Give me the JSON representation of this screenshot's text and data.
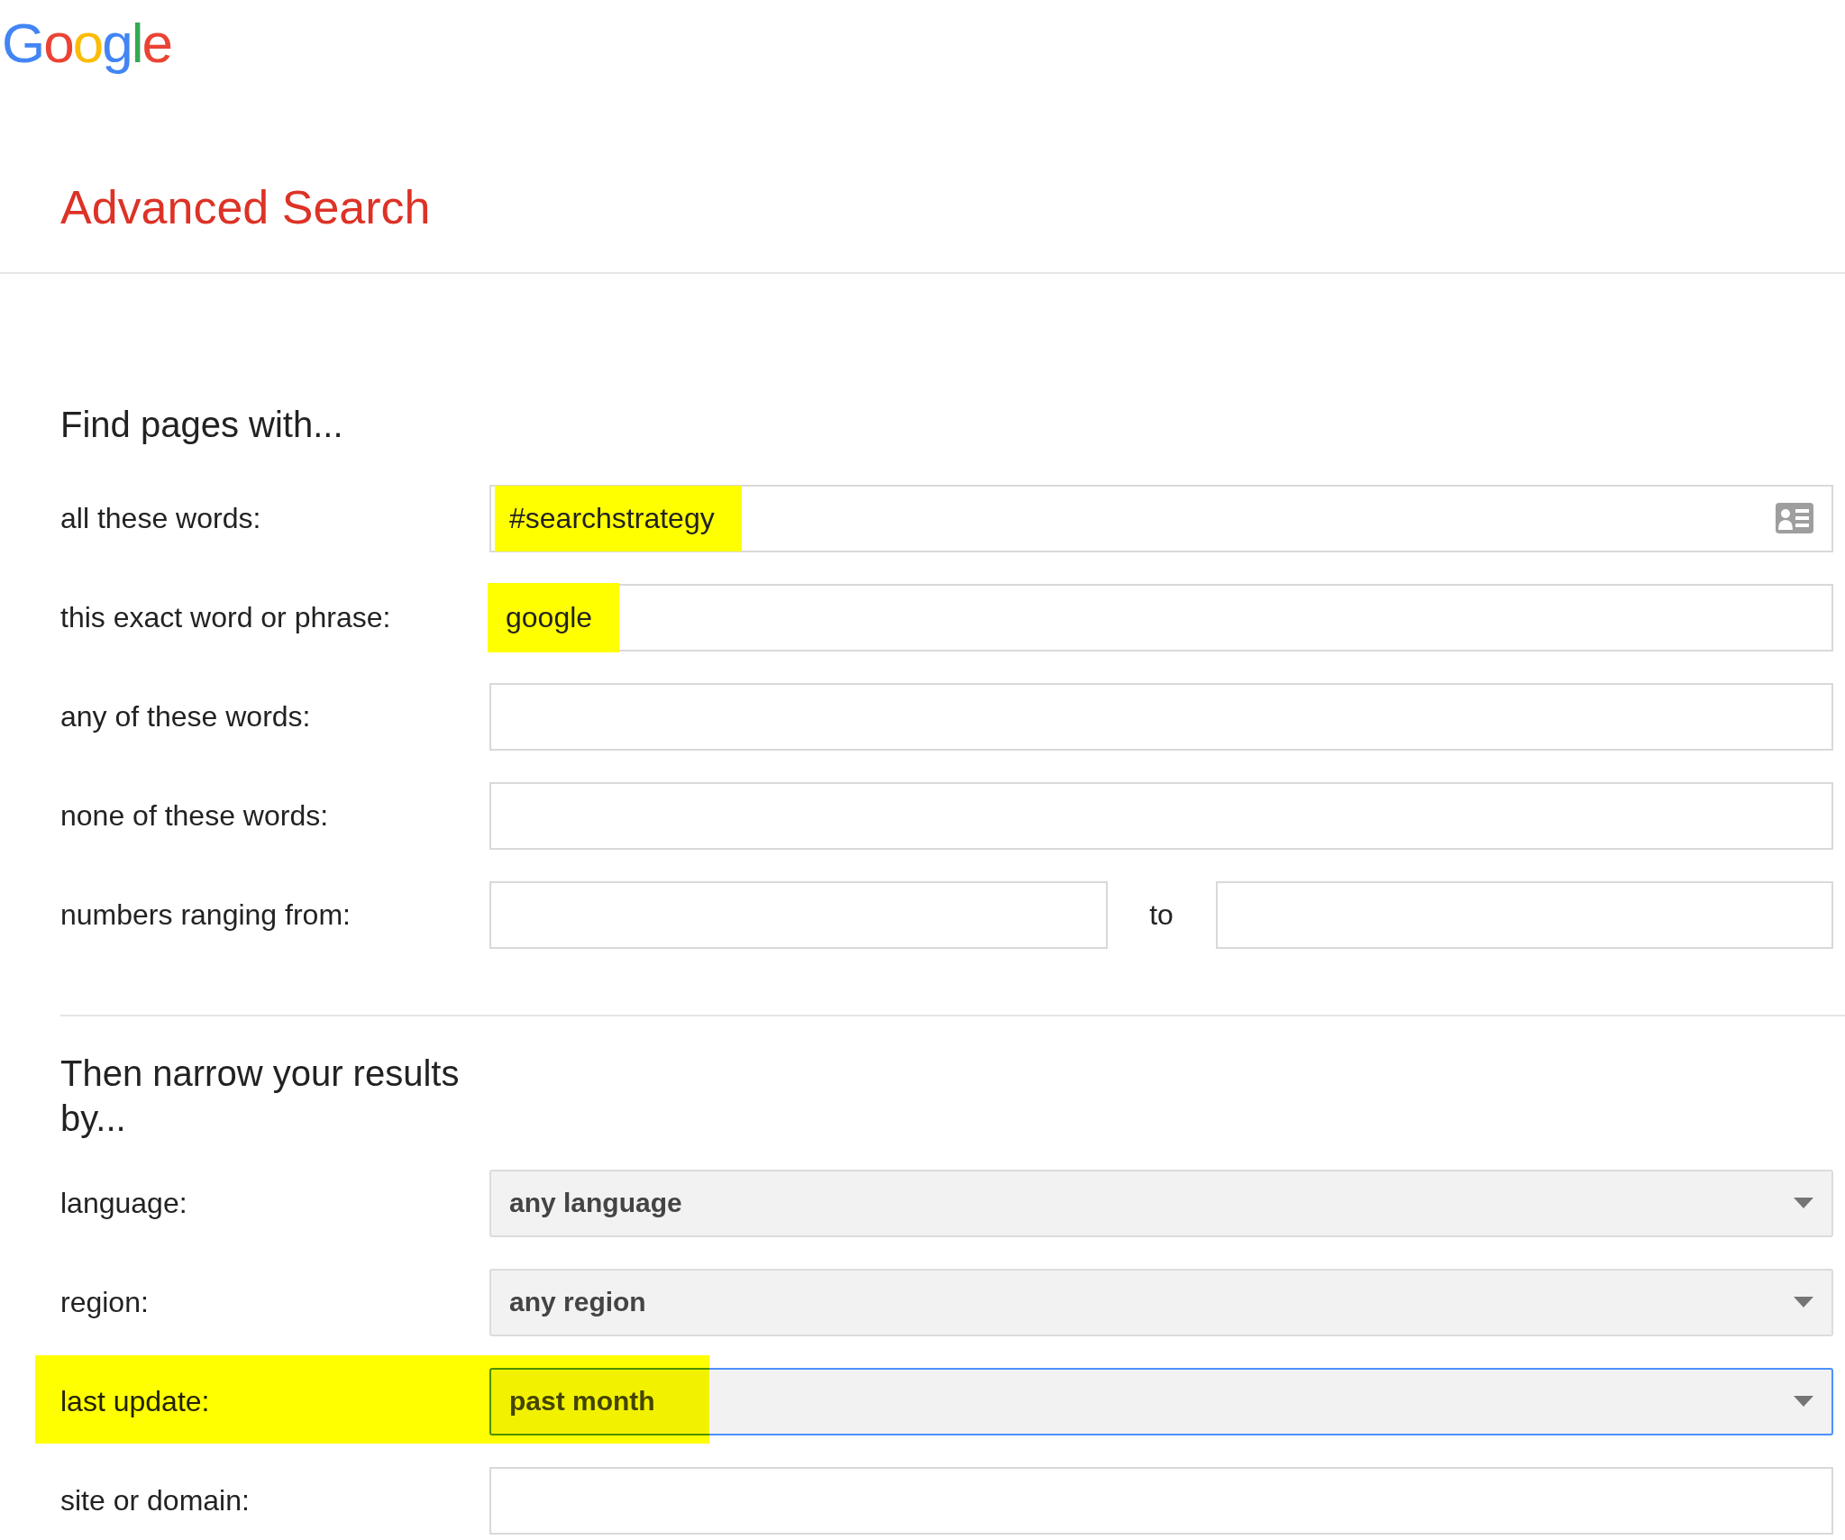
{
  "logo": "Google",
  "title": "Advanced Search",
  "find_section": {
    "heading": "Find pages with...",
    "rows": [
      {
        "label": "all these words:",
        "kind": "text",
        "value": "#searchstrategy",
        "highlighted": true,
        "keyboard": true
      },
      {
        "label": "this exact word or phrase:",
        "kind": "text",
        "value": "google",
        "highlighted": true
      },
      {
        "label": "any of these words:",
        "kind": "text"
      },
      {
        "label": "none of these words:",
        "kind": "text"
      },
      {
        "label": "numbers ranging from:",
        "kind": "range",
        "separator": "to"
      }
    ]
  },
  "narrow_section": {
    "heading": "Then narrow your results by...",
    "rows": [
      {
        "label": "language:",
        "kind": "select",
        "value": "any language",
        "highlighted": false,
        "focused": false
      },
      {
        "label": "region:",
        "kind": "select",
        "value": "any region",
        "highlighted": false,
        "focused": false
      },
      {
        "label": "last update:",
        "kind": "select",
        "value": "past month",
        "highlighted": true,
        "focused": true
      },
      {
        "label": "site or domain:",
        "kind": "text"
      }
    ]
  }
}
